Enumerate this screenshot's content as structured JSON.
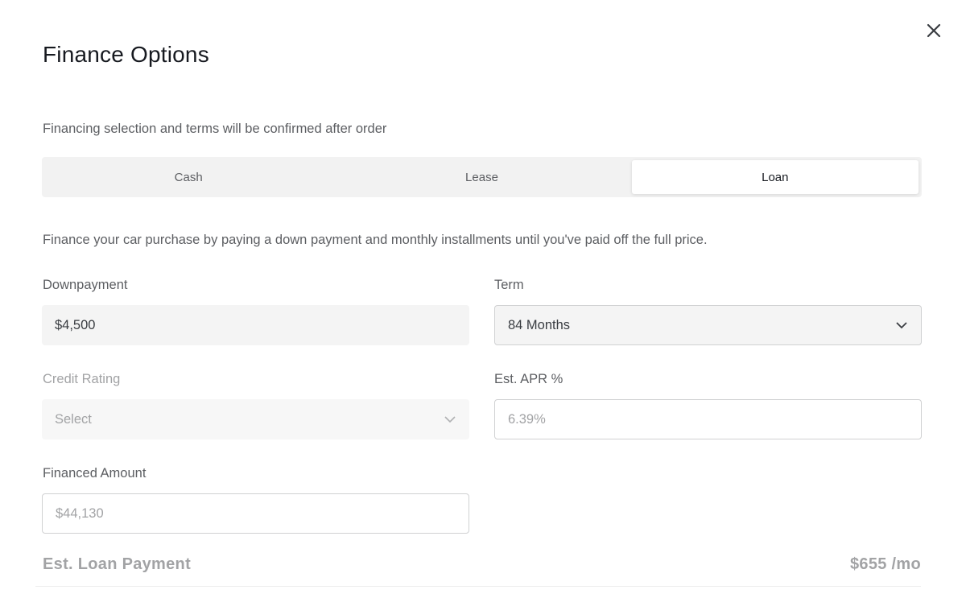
{
  "modal": {
    "title": "Finance Options",
    "close_icon": "close-icon",
    "subtitle": "Financing selection and terms will be confirmed after order"
  },
  "tabs": [
    {
      "label": "Cash",
      "active": false
    },
    {
      "label": "Lease",
      "active": false
    },
    {
      "label": "Loan",
      "active": true
    }
  ],
  "loan": {
    "description": "Finance your car purchase by paying a down payment and monthly installments until you've paid off the full price.",
    "downpayment": {
      "label": "Downpayment",
      "value": "$4,500"
    },
    "term": {
      "label": "Term",
      "selected": "84 Months",
      "icon": "chevron-down-icon"
    },
    "credit_rating": {
      "label": "Credit Rating",
      "placeholder": "Select",
      "icon": "chevron-down-icon",
      "disabled": true
    },
    "apr": {
      "label": "Est. APR %",
      "value": "6.39%"
    },
    "financed_amount": {
      "label": "Financed Amount",
      "value": "$44,130"
    },
    "payment": {
      "label": "Est. Loan Payment",
      "value": "$655 /mo"
    }
  }
}
